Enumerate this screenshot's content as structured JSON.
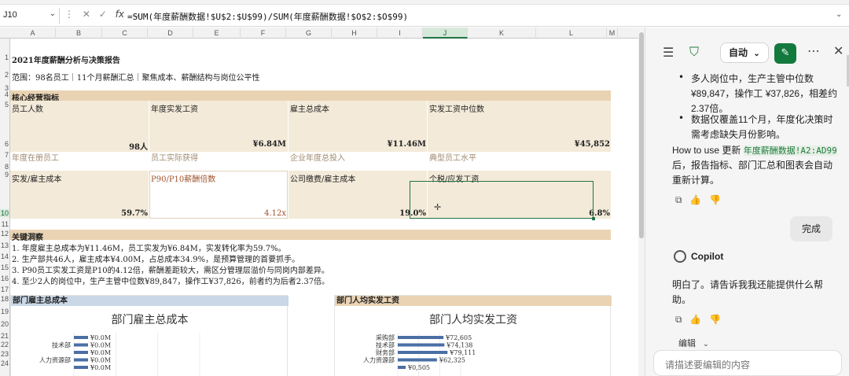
{
  "formula_bar": {
    "name_box": "J10",
    "caret": "⌄",
    "tools": [
      "⋮",
      "✕",
      "✓",
      "fx",
      "⌄"
    ],
    "formula": "=SUM(年度薪酬数据!$U$2:$U$99)/SUM(年度薪酬数据!$O$2:$O$99)",
    "expand": "⌄"
  },
  "sheet": {
    "columns": [
      "A",
      "B",
      "C",
      "D",
      "E",
      "F",
      "G",
      "H",
      "I",
      "J",
      "K",
      "L",
      "M"
    ],
    "selected_column": "J",
    "rows": [
      "1",
      "2",
      "3",
      "4",
      "5",
      "6",
      "7",
      "8",
      "9",
      "10",
      "11",
      "12",
      "13",
      "14",
      "15",
      "16",
      "17",
      "18",
      "19",
      "20",
      "21",
      "22",
      "23",
      "24"
    ],
    "selected_row": "10",
    "title": "2021年度薪酬分析与决策报告",
    "scope": "范围：98名员工｜11个月薪酬汇总｜聚焦成本、薪酬结构与岗位公平性",
    "kpi_section": "核心经营指标",
    "kpis_row1": [
      {
        "label": "员工人数",
        "value": "98人",
        "sub": "年度在册员工"
      },
      {
        "label": "年度实发工资",
        "value": "¥6.84M",
        "sub": "员工实际获得"
      },
      {
        "label": "雇主总成本",
        "value": "¥11.46M",
        "sub": "企业年度总投入"
      },
      {
        "label": "实发工资中位数",
        "value": "¥45,852",
        "sub": "典型员工水平"
      }
    ],
    "kpis_row2": [
      {
        "label": "实发/雇主成本",
        "value": "59.7%"
      },
      {
        "label": "P90/P10薪酬倍数",
        "value": "4.12x"
      },
      {
        "label": "公司缴费/雇主成本",
        "value": "19.0%"
      },
      {
        "label": "个税/应发工资",
        "value": "6.8%"
      }
    ],
    "insights_section": "关键洞察",
    "insights": [
      "1.  年度雇主总成本为¥11.46M，员工实发为¥6.84M，实发转化率为59.7%。",
      "2.  生产部共46人，雇主成本¥4.00M，占总成本34.9%，是预算管理的首要抓手。",
      "3.  P90员工实发工资是P10的4.12倍，薪酬差距较大，需区分管理层溢价与同岗内部差异。",
      "4.  至少2人的岗位中，生产主管中位数¥89,847，操作工¥37,826，前者约为后者2.37倍。"
    ]
  },
  "charts": [
    {
      "section": "部门雇主总成本",
      "section_color": "#c9d7e6",
      "chart_data": {
        "type": "bar",
        "title": "部门雇主总成本",
        "categories": [
          "",
          "技术部",
          "",
          "人力资源部",
          ""
        ],
        "values": [
          0.0,
          0.0,
          0.0,
          0.0,
          0.0
        ],
        "data_labels": [
          "¥0.0M",
          "¥0.0M",
          "¥0.0M",
          "¥0.0M",
          "¥0.0M"
        ],
        "ylabel": "",
        "bar_color": "#4a6fa5",
        "ylim": [
          0,
          1
        ]
      }
    },
    {
      "section": "部门人均实发工资",
      "section_color": "#e9d3b3",
      "chart_data": {
        "type": "bar",
        "title": "部门人均实发工资",
        "categories": [
          "采购部",
          "技术部",
          "财务部",
          "人力资源部",
          ""
        ],
        "values": [
          72605,
          74138,
          79111,
          62325,
          0
        ],
        "data_labels": [
          "¥72,605",
          "¥74,138",
          "¥79,111",
          "¥62,325",
          "¥0,505"
        ],
        "bar_color": "#4a6fa5",
        "xlim": [
          0,
          100000
        ]
      }
    }
  ],
  "copilot": {
    "auto_label": "自动",
    "bullets": [
      "多人岗位中，生产主管中位数¥89,847，操作工 ¥37,826，相差约 2.37倍。",
      "数据仅覆盖11个月，年度化决策时需考虑缺失月份影响。"
    ],
    "howto_prefix": "How to use 更新",
    "howto_code": "年度薪酬数据!A2:AD99",
    "howto_suffix": "后，报告指标、部门汇总和图表会自动重新计算。",
    "done_label": "完成",
    "copilot_name": "Copilot",
    "reply": "明白了。请告诉我我还能提供什么帮助。",
    "edit_label": "编辑",
    "input_placeholder": "请描述要编辑的内容"
  }
}
